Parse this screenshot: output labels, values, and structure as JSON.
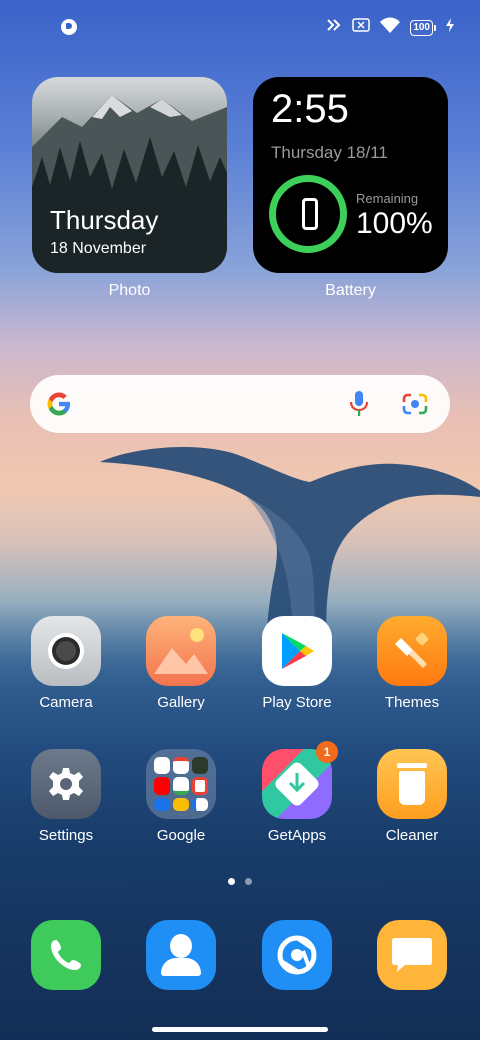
{
  "status_bar": {
    "battery_level": "100",
    "icons": [
      "notification-icon",
      "signal-icon",
      "no-sim-icon",
      "wifi-icon",
      "battery-icon",
      "charging-icon"
    ]
  },
  "widgets": {
    "photo": {
      "day": "Thursday",
      "date": "18 November",
      "caption": "Photo"
    },
    "battery": {
      "time": "2:55",
      "date": "Thursday 18/11",
      "remaining_label": "Remaining",
      "remaining_value": "100%",
      "caption": "Battery",
      "ring_color": "#3ccf5a"
    }
  },
  "search": {
    "icons": [
      "google-icon",
      "mic-icon",
      "lens-icon"
    ]
  },
  "apps": {
    "camera": "Camera",
    "gallery": "Gallery",
    "play_store": "Play Store",
    "themes": "Themes",
    "settings": "Settings",
    "google": "Google",
    "getapps": "GetApps",
    "getapps_badge": "1",
    "cleaner": "Cleaner"
  },
  "dock": [
    "phone-icon",
    "contacts-icon",
    "browser-icon",
    "messages-icon"
  ],
  "pages": {
    "count": 2,
    "active": 1
  }
}
